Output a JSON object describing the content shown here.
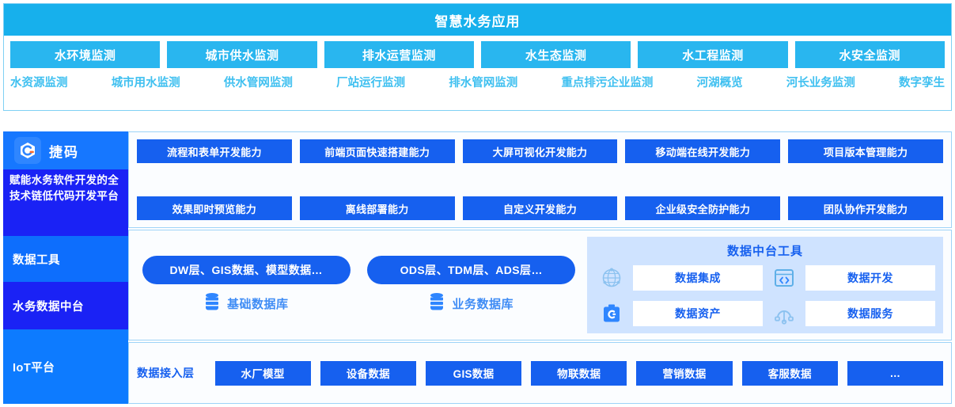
{
  "application": {
    "title": "智慧水务应用",
    "modules": [
      "水环境监测",
      "城市供水监测",
      "排水运营监测",
      "水生态监测",
      "水工程监测",
      "水安全监测"
    ],
    "sub_modules": [
      "水资源监测",
      "城市用水监测",
      "供水管网监测",
      "厂站运行监测",
      "排水管网监测",
      "重点排污企业监测",
      "河湖概览",
      "河长业务监测",
      "数字孪生"
    ]
  },
  "platform": {
    "brand": {
      "name": "捷码",
      "icon": "hexagon-c-logo",
      "description": "赋能水务软件开发的全技术链低代码开发平台"
    },
    "sidebar": [
      {
        "label": "数据工具"
      },
      {
        "label": "水务数据中台"
      },
      {
        "label": "IoT平台"
      }
    ],
    "capabilities": {
      "row1": [
        "流程和表单开发能力",
        "前端页面快速搭建能力",
        "大屏可视化开发能力",
        "移动端在线开发能力",
        "项目版本管理能力"
      ],
      "row2": [
        "效果即时预览能力",
        "离线部署能力",
        "自定义开发能力",
        "企业级安全防护能力",
        "团队协作开发能力"
      ]
    },
    "data_layer": {
      "databases": [
        {
          "pill": "DW层、GIS数据、模型数据…",
          "label": "基础数据库",
          "icon": "database-icon"
        },
        {
          "pill": "ODS层、TDM层、ADS层…",
          "label": "业务数据库",
          "icon": "database-icon"
        }
      ],
      "tools": {
        "title": "数据中台工具",
        "items": [
          {
            "label": "数据集成",
            "icon": "globe-network-icon"
          },
          {
            "label": "数据开发",
            "icon": "code-window-icon"
          },
          {
            "label": "数据资产",
            "icon": "briefcase-asset-icon"
          },
          {
            "label": "数据服务",
            "icon": "api-node-icon"
          }
        ]
      }
    },
    "iot": {
      "label": "数据接入层",
      "sources": [
        "水厂模型",
        "设备数据",
        "GIS数据",
        "物联数据",
        "营销数据",
        "客服数据",
        "…"
      ]
    }
  },
  "colors": {
    "app_header": "#17b0ec",
    "app_chip": "#29b6ef",
    "sub_link": "#3fc0f0",
    "brand_blue": "#1677ff",
    "deep_blue": "#1a22f5",
    "chip_blue": "#1660ef",
    "tools_bg": "#cfe3ff"
  }
}
